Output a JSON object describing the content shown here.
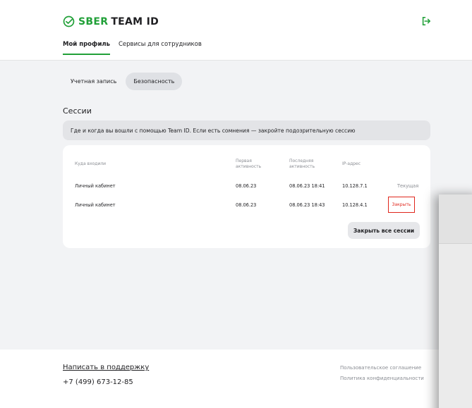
{
  "brand": {
    "sber": "SBER",
    "team": "TEAM ID",
    "accent": "#21a038"
  },
  "nav": {
    "tabs": [
      {
        "label": "Мой профиль"
      },
      {
        "label": "Сервисы для сотрудников"
      }
    ]
  },
  "subtabs": [
    {
      "label": "Учетная запись"
    },
    {
      "label": "Безопасность"
    }
  ],
  "sessions": {
    "title": "Сессии",
    "info": "Где и когда вы вошли с помощью Team ID. Если есть сомнения — закройте подозрительную сессию",
    "headers": {
      "where": "Куда входили",
      "first": [
        "Первая",
        "активность"
      ],
      "last": [
        "Последняя",
        "активность"
      ],
      "ip": "IP-адрес"
    },
    "rows": [
      {
        "where": "Личный кабинет",
        "first": "08.06.23",
        "last": "08.06.23 18:41",
        "ip": "10.128.7.1",
        "status": "Текущая"
      },
      {
        "where": "Личный кабинет",
        "first": "08.06.23",
        "last": "08.06.23 18:43",
        "ip": "10.128.4.1",
        "action": "Закрыть"
      }
    ],
    "close_all": "Закрыть все сессии",
    "danger_color": "#e0261c"
  },
  "footer": {
    "support": "Написать в поддержку",
    "phone": "+7 (499) 673-12-85",
    "links": [
      "Пользовательское соглашение",
      "Политика конфиденциальности"
    ]
  }
}
